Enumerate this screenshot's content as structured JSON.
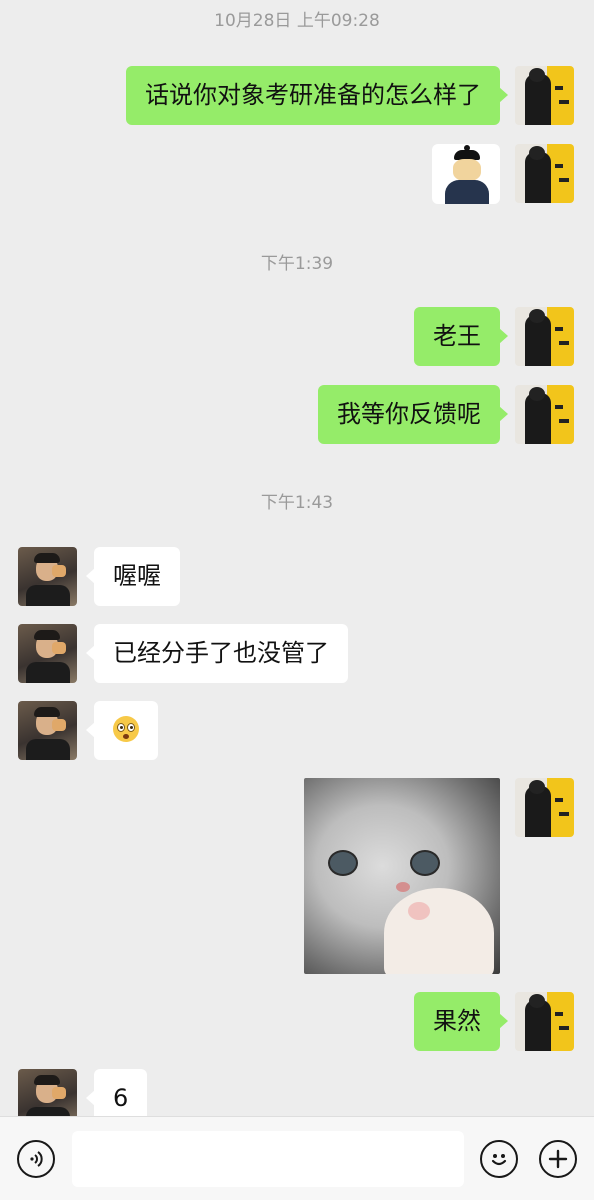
{
  "messages": {
    "timestamp_1": "10月28日 上午09:28",
    "msg_1": "话说你对象考研准备的怎么样了",
    "timestamp_2": "下午1:39",
    "msg_3": "老王",
    "msg_4": "我等你反馈呢",
    "timestamp_3": "下午1:43",
    "msg_5": "喔喔",
    "msg_6": "已经分手了也没管了",
    "msg_10": "果然",
    "msg_11": "6"
  },
  "stickers": {
    "sticker_1": "doge-official-sticker",
    "emoji_1": "flushed-face-emoji",
    "sticker_2": "cat-pointing-sticker"
  },
  "input_bar": {
    "voice_icon": "voice-icon",
    "emoji_icon": "smiley-icon",
    "plus_icon": "plus-icon",
    "text_value": ""
  },
  "colors": {
    "my_bubble": "#95ec69",
    "their_bubble": "#ffffff",
    "background": "#ededed"
  }
}
